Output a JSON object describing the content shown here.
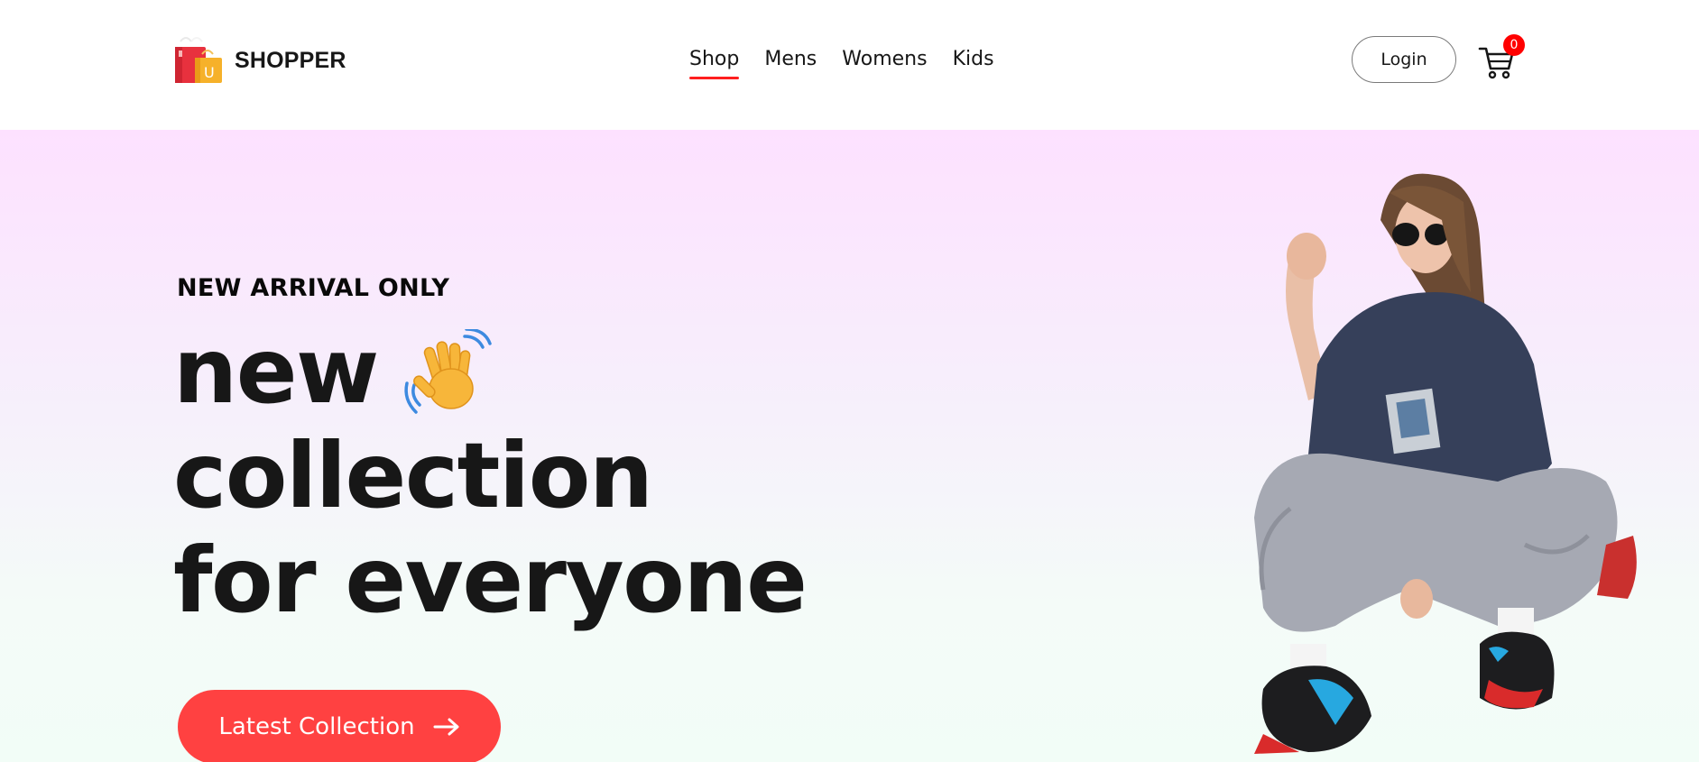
{
  "brand": {
    "name": "SHOPPER",
    "logo_icon": "shopping-bags-icon"
  },
  "nav": {
    "items": [
      {
        "label": "Shop",
        "active": true
      },
      {
        "label": "Mens",
        "active": false
      },
      {
        "label": "Womens",
        "active": false
      },
      {
        "label": "Kids",
        "active": false
      }
    ],
    "login_label": "Login",
    "cart_icon": "cart-icon",
    "cart_count": "0"
  },
  "hero": {
    "eyebrow": "NEW ARRIVAL ONLY",
    "title_lines": [
      "new",
      "collection",
      "for everyone"
    ],
    "wave_icon": "waving-hand-icon",
    "cta_label": "Latest Collection",
    "cta_icon": "arrow-right-icon",
    "image": "hero-model-image"
  },
  "colors": {
    "accent": "#ff4141",
    "active_underline": "#ff1f1f",
    "badge": "#ff0000",
    "hero_gradient_top": "#fde1ff",
    "hero_gradient_bottom": "#f2fdf7",
    "text": "#171717"
  }
}
